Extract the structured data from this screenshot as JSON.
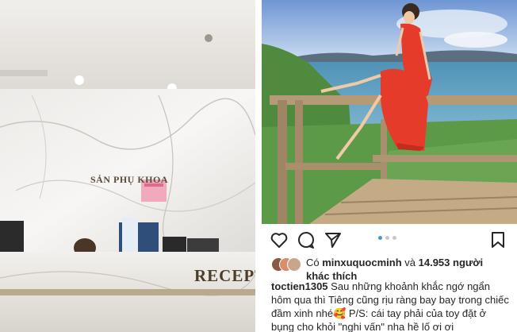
{
  "left_photo": {
    "sign_text": "SẢN PHỤ KHOA",
    "desk_text": "RECEPT"
  },
  "post": {
    "icons": {
      "like": "heart-icon",
      "comment": "comment-icon",
      "share": "send-icon",
      "save": "bookmark-icon"
    },
    "carousel": {
      "current": 1,
      "total": 3
    },
    "likes": {
      "prefix": "Có",
      "user": "minxuquocminh",
      "middle": "và",
      "count": "14.953",
      "suffix": "người khác thích"
    },
    "caption": {
      "username": "toctien1305",
      "text": "Sau những khoảnh khắc ngớ ngẩn hôm qua thì Tiêng cũng rịu ràng bay bay trong chiếc đầm xinh      nhé🥰 P/S: cái tay phải của toy đặt ở bụng cho khỏi \"nghi vấn\" nha hề lố ơi ơi"
    }
  },
  "colors": {
    "accent": "#3897f0",
    "text": "#262626",
    "dress": "#e53b2a"
  }
}
